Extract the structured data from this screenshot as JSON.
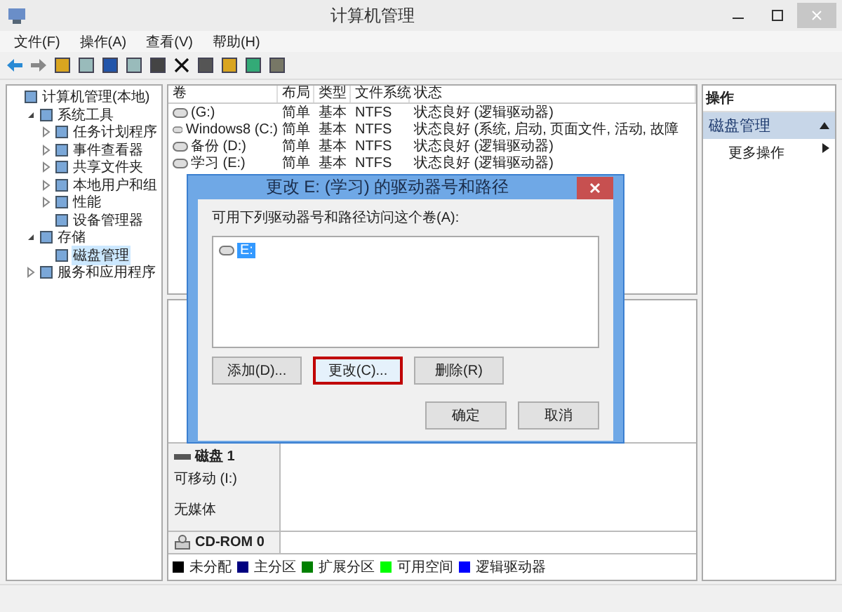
{
  "window": {
    "title": "计算机管理"
  },
  "menu": [
    "文件(F)",
    "操作(A)",
    "查看(V)",
    "帮助(H)"
  ],
  "tree": [
    {
      "label": "计算机管理(本地)",
      "selected": false,
      "children": [
        {
          "label": "系统工具",
          "expanded": true,
          "selected": false,
          "children": [
            {
              "label": "任务计划程序",
              "expanded": false,
              "selected": false
            },
            {
              "label": "事件查看器",
              "expanded": false,
              "selected": false
            },
            {
              "label": "共享文件夹",
              "expanded": false,
              "selected": false
            },
            {
              "label": "本地用户和组",
              "expanded": false,
              "selected": false
            },
            {
              "label": "性能",
              "expanded": false,
              "selected": false
            },
            {
              "label": "设备管理器",
              "selected": false
            }
          ]
        },
        {
          "label": "存储",
          "expanded": true,
          "selected": false,
          "children": [
            {
              "label": "磁盘管理",
              "selected": true
            }
          ]
        },
        {
          "label": "服务和应用程序",
          "expanded": false,
          "selected": false
        }
      ]
    }
  ],
  "table": {
    "columns": [
      "卷",
      "布局",
      "类型",
      "文件系统",
      "状态"
    ],
    "rows": [
      [
        "(G:)",
        "简单",
        "基本",
        "NTFS",
        "状态良好 (逻辑驱动器)"
      ],
      [
        "Windows8 (C:)",
        "简单",
        "基本",
        "NTFS",
        "状态良好 (系统, 启动, 页面文件, 活动, 故障"
      ],
      [
        "备份 (D:)",
        "简单",
        "基本",
        "NTFS",
        "状态良好 (逻辑驱动器)"
      ],
      [
        "学习 (E:)",
        "简单",
        "基本",
        "NTFS",
        "状态良好 (逻辑驱动器)"
      ]
    ]
  },
  "disks": [
    {
      "kind": "removable",
      "name": "磁盘 1",
      "lines": [
        "可移动 (I:)",
        "无媒体"
      ]
    },
    {
      "kind": "cdrom",
      "name": "CD-ROM 0"
    }
  ],
  "legend": [
    {
      "label": "未分配",
      "color": "#000000"
    },
    {
      "label": "主分区",
      "color": "#000080"
    },
    {
      "label": "扩展分区",
      "color": "#008000"
    },
    {
      "label": "可用空间",
      "color": "#00ff00"
    },
    {
      "label": "逻辑驱动器",
      "color": "#0000ff"
    }
  ],
  "actions": {
    "title": "操作",
    "section": {
      "label": "磁盘管理",
      "expanded": true
    },
    "items": [
      "更多操作"
    ]
  },
  "dialog": {
    "title": "更改 E: (学习) 的驱动器号和路径",
    "prompt": "可用下列驱动器号和路径访问这个卷(A):",
    "paths": [
      {
        "label": "E:",
        "selected": true
      }
    ],
    "buttons": [
      {
        "label": "添加(D)...",
        "highlighted": false
      },
      {
        "label": "更改(C)...",
        "highlighted": true
      },
      {
        "label": "删除(R)",
        "highlighted": false
      }
    ],
    "footer_buttons": [
      "确定",
      "取消"
    ]
  }
}
